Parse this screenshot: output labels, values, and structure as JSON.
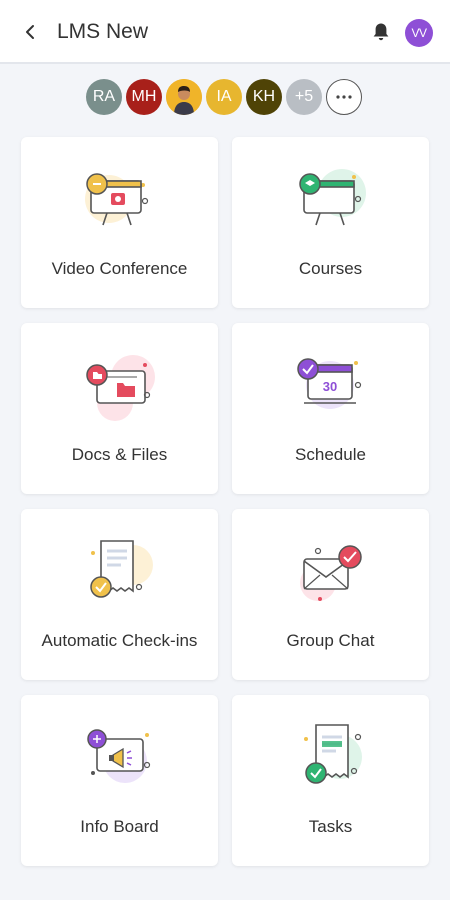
{
  "header": {
    "title": "LMS New",
    "user_initials": "VV"
  },
  "members": [
    {
      "initials": "RA",
      "color": "#7a8f8c"
    },
    {
      "initials": "MH",
      "color": "#a8201a"
    },
    {
      "initials": "",
      "color": "#e9a825",
      "photo": true
    },
    {
      "initials": "IA",
      "color": "#e7b62f"
    },
    {
      "initials": "KH",
      "color": "#4f4306"
    },
    {
      "initials": "+5",
      "color": "#b9bec4"
    }
  ],
  "more_label": "···",
  "modules": [
    {
      "label": "Video Conference",
      "icon": "video-conference-icon"
    },
    {
      "label": "Courses",
      "icon": "courses-icon"
    },
    {
      "label": "Docs & Files",
      "icon": "docs-files-icon"
    },
    {
      "label": "Schedule",
      "icon": "schedule-icon",
      "icon_text": "30"
    },
    {
      "label": "Automatic Check-ins",
      "icon": "automatic-check-ins-icon"
    },
    {
      "label": "Group Chat",
      "icon": "group-chat-icon"
    },
    {
      "label": "Info Board",
      "icon": "info-board-icon"
    },
    {
      "label": "Tasks",
      "icon": "tasks-icon"
    }
  ]
}
